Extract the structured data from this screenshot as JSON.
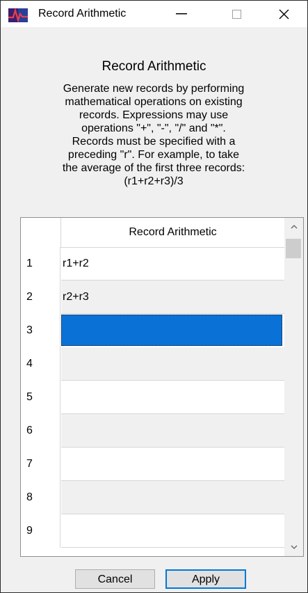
{
  "window": {
    "title": "Record Arithmetic",
    "controls": [
      "minimize",
      "maximize",
      "close"
    ]
  },
  "header": {
    "heading": "Record Arithmetic",
    "description": "Generate new records by performing\nmathematical operations on existing\nrecords. Expressions may use\noperations \"+\", \"-\", \"/\" and \"*\".\nRecords must be specified with a\npreceding \"r\". For example, to take\nthe average of the first three records:\n(r1+r2+r3)/3"
  },
  "grid": {
    "column_header": "Record Arithmetic",
    "rows": [
      {
        "num": "1",
        "value": "r1+r2"
      },
      {
        "num": "2",
        "value": "r2+r3"
      },
      {
        "num": "3",
        "value": ""
      },
      {
        "num": "4",
        "value": ""
      },
      {
        "num": "5",
        "value": ""
      },
      {
        "num": "6",
        "value": ""
      },
      {
        "num": "7",
        "value": ""
      },
      {
        "num": "8",
        "value": ""
      },
      {
        "num": "9",
        "value": ""
      }
    ],
    "selected_row": "3"
  },
  "buttons": {
    "cancel": "Cancel",
    "apply": "Apply"
  },
  "colors": {
    "selection": "#0a72d6",
    "default_button_border": "#0078d7"
  }
}
